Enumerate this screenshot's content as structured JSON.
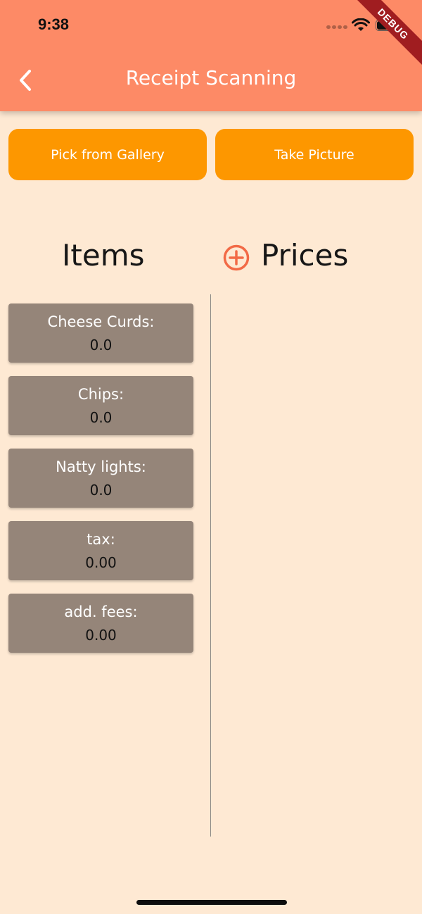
{
  "status_bar": {
    "time": "9:38",
    "icons": [
      "signal-dots-icon",
      "wifi-icon",
      "battery-icon"
    ],
    "debug_banner": "DEBUG"
  },
  "header": {
    "title": "Receipt Scanning",
    "back_icon": "chevron-left-icon"
  },
  "actions": {
    "gallery_label": "Pick from Gallery",
    "camera_label": "Take Picture"
  },
  "columns": {
    "items_heading": "Items",
    "prices_heading": "Prices",
    "add_icon": "plus-circle-icon"
  },
  "items": [
    {
      "name": "Cheese Curds:",
      "price": "0.0"
    },
    {
      "name": "Chips:",
      "price": "0.0"
    },
    {
      "name": "Natty lights:",
      "price": "0.0"
    },
    {
      "name": "tax:",
      "price": "0.00"
    },
    {
      "name": "add. fees:",
      "price": "0.00"
    }
  ],
  "colors": {
    "app_bar": "#fd8a66",
    "background": "#fee9d3",
    "button": "#fd9700",
    "item_card": "#958579",
    "accent": "#f26a46"
  }
}
